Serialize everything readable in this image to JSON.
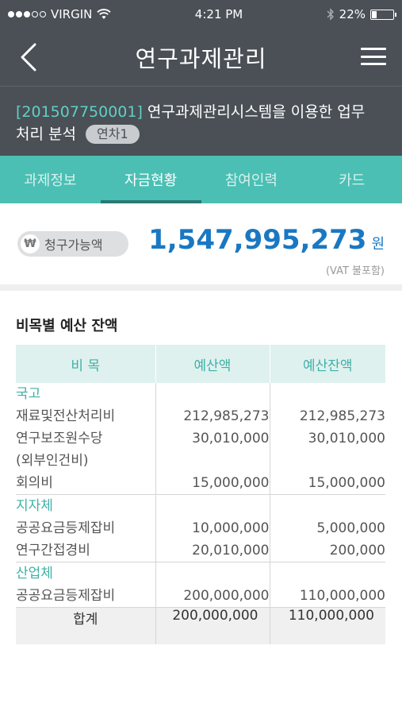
{
  "status_bar": {
    "carrier": "VIRGIN",
    "time": "4:21 PM",
    "battery": "22%",
    "battery_level": 0.22
  },
  "nav": {
    "title": "연구과제관리",
    "back_icon": "chevron-left-icon",
    "menu_icon": "hamburger-menu-icon"
  },
  "project": {
    "code": "[201507750001]",
    "name": "연구과제관리시스템을 이용한 업무처리 분석",
    "name_line1": " 연구과제관리시스템을 이용한 업무",
    "name_line2": "처리 분석",
    "badge": "연차1"
  },
  "tabs": [
    {
      "label": "과제정보"
    },
    {
      "label": "자금현황"
    },
    {
      "label": "참여인력"
    },
    {
      "label": "카드"
    }
  ],
  "active_tab": "자금현황",
  "claimable": {
    "label": "청구가능액",
    "icon_symbol": "₩",
    "amount": "1,547,995,273",
    "unit": "원",
    "note": "(VAT 불포함)"
  },
  "budget": {
    "title": "비목별 예산 잔액",
    "headers": {
      "item": "비 목",
      "budget": "예산액",
      "balance": "예산잔액"
    },
    "groups": [
      {
        "name": "국고",
        "rows": [
          {
            "item": "재료및전산처리비",
            "budget": "212,985,273",
            "balance": "212,985,273"
          },
          {
            "item": "연구보조원수당",
            "budget": "30,010,000",
            "balance": "30,010,000"
          },
          {
            "item": "(외부인건비)",
            "budget": "",
            "balance": ""
          },
          {
            "item": "회의비",
            "budget": "15,000,000",
            "balance": "15,000,000"
          }
        ]
      },
      {
        "name": "지자체",
        "rows": [
          {
            "item": "공공요금등제잡비",
            "budget": "10,000,000",
            "balance": "5,000,000"
          },
          {
            "item": "연구간접경비",
            "budget": "20,010,000",
            "balance": "200,000"
          }
        ]
      },
      {
        "name": "산업체",
        "rows": [
          {
            "item": "공공요금등제잡비",
            "budget": "200,000,000",
            "balance": "110,000,000"
          }
        ]
      }
    ],
    "total": {
      "label": "합계",
      "budget": "200,000,000",
      "balance": "110,000,000"
    }
  },
  "colors": {
    "header_bg": "#4a5056",
    "accent_teal": "#4bbfb4",
    "amount_blue": "#1a78c2",
    "project_code": "#5fd0c6"
  }
}
